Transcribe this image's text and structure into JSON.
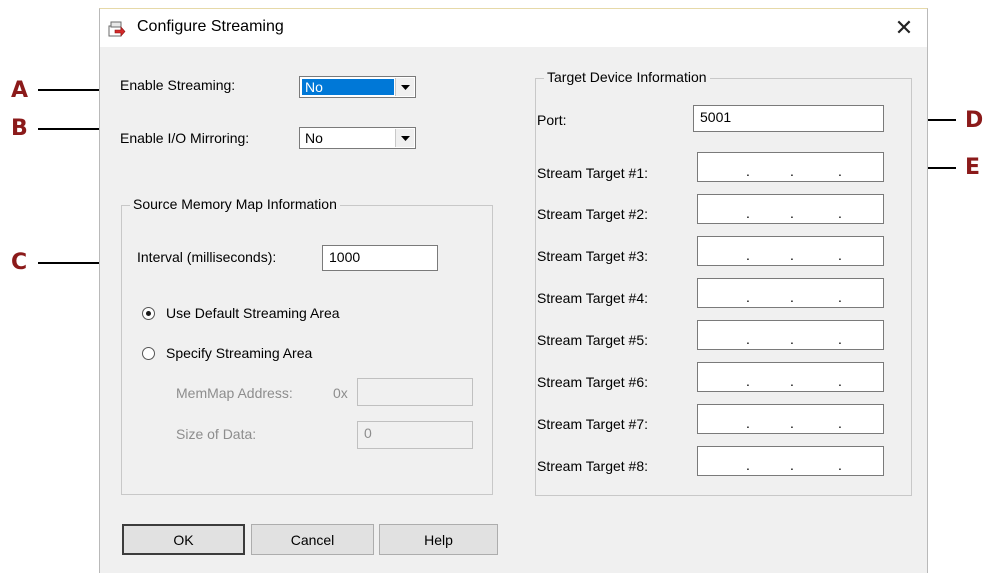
{
  "callouts": {
    "a": "A",
    "b": "B",
    "c": "C",
    "d": "D",
    "e": "E"
  },
  "dialog": {
    "title": "Configure Streaming",
    "close_symbol": "✕",
    "icon": "streaming-app-icon"
  },
  "enable_streaming": {
    "label": "Enable Streaming:",
    "value": "No"
  },
  "enable_mirroring": {
    "label": "Enable I/O Mirroring:",
    "value": "No"
  },
  "source_group": {
    "title": "Source Memory Map Information",
    "interval_label": "Interval (milliseconds):",
    "interval_value": "1000",
    "radio_default": "Use Default Streaming Area",
    "radio_specify": "Specify Streaming Area",
    "memmap_label": "MemMap Address:",
    "memmap_prefix": "0x",
    "memmap_value": "",
    "size_label": "Size of Data:",
    "size_value": "0"
  },
  "target_group": {
    "title": "Target Device Information",
    "port_label": "Port:",
    "port_value": "5001",
    "targets": [
      {
        "label": "Stream Target #1:"
      },
      {
        "label": "Stream Target #2:"
      },
      {
        "label": "Stream Target #3:"
      },
      {
        "label": "Stream Target #4:"
      },
      {
        "label": "Stream Target #5:"
      },
      {
        "label": "Stream Target #6:"
      },
      {
        "label": "Stream Target #7:"
      },
      {
        "label": "Stream Target #8:"
      }
    ],
    "ip_dot": "."
  },
  "buttons": {
    "ok": "OK",
    "cancel": "Cancel",
    "help": "Help"
  },
  "colors": {
    "callout": "#8b1a1a",
    "selection": "#0078d7",
    "dialog_bg": "#f0f0f0"
  }
}
